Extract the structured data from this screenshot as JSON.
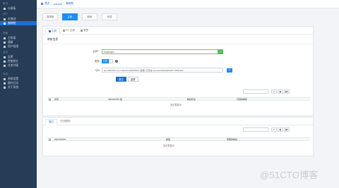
{
  "sidebar": {
    "groups": [
      {
        "title": "概况",
        "items": [
          {
            "label": "仪表板",
            "active": false
          }
        ]
      },
      {
        "title": "资产",
        "items": [
          {
            "label": "存储池",
            "active": false
          },
          {
            "label": "卷映射",
            "active": true
          }
        ]
      },
      {
        "title": "配置",
        "items": [
          {
            "label": "主机组",
            "active": false
          },
          {
            "label": "通道",
            "active": false
          },
          {
            "label": "用户权限",
            "active": false
          }
        ]
      },
      {
        "title": "监控",
        "items": [
          {
            "label": "告警",
            "active": false
          },
          {
            "label": "性能统计",
            "active": false
          },
          {
            "label": "任务列表",
            "active": false
          }
        ]
      },
      {
        "title": "系统",
        "items": [
          {
            "label": "系统设置",
            "active": false
          },
          {
            "label": "操作日志",
            "active": false
          },
          {
            "label": "关于系统",
            "active": false
          }
        ]
      }
    ]
  },
  "breadcrumb": {
    "items": [
      "首页",
      "volume",
      "卷映射"
    ]
  },
  "steps": [
    "选择卷",
    "主机",
    "映射",
    "完成"
  ],
  "panel1": {
    "tabs": [
      "主机",
      "FC 主机",
      "更多"
    ],
    "section_title": "映射信息",
    "name_label": "名称",
    "name_value": "hostmap1",
    "ok_mark": "✓",
    "os_label": "类型",
    "os_toggle": "打开",
    "iqn_label": "IQN",
    "iqn_value": "iqn.1994-05.com.redhat:fe16a57b8c0 (选择) 已存在 iqn:ww-b60cab2fca6b 7945c4b9",
    "plus_label": "+",
    "submit_label": "提交",
    "reset_label": "重置",
    "table": {
      "headers": [
        "名称",
        "IQN/WWPN 组",
        "映射状态",
        "可用的映射"
      ],
      "empty_text": "无记录显示"
    }
  },
  "panel2": {
    "tabs": [
      "端口",
      "已分配的"
    ],
    "table": {
      "headers": [
        "IQN/WWPN",
        "类型",
        "所属的映射"
      ],
      "empty_text": "无记录显示"
    }
  },
  "toolbar": {
    "refresh": "⟳",
    "columns": "▦",
    "menu": "▦▾"
  },
  "watermark": "@51CTO博客",
  "colors": {
    "sidebar": "#263d57",
    "accent": "#1f6ed4",
    "step_active": "#1f8cf0",
    "ok": "#5cb85c"
  }
}
